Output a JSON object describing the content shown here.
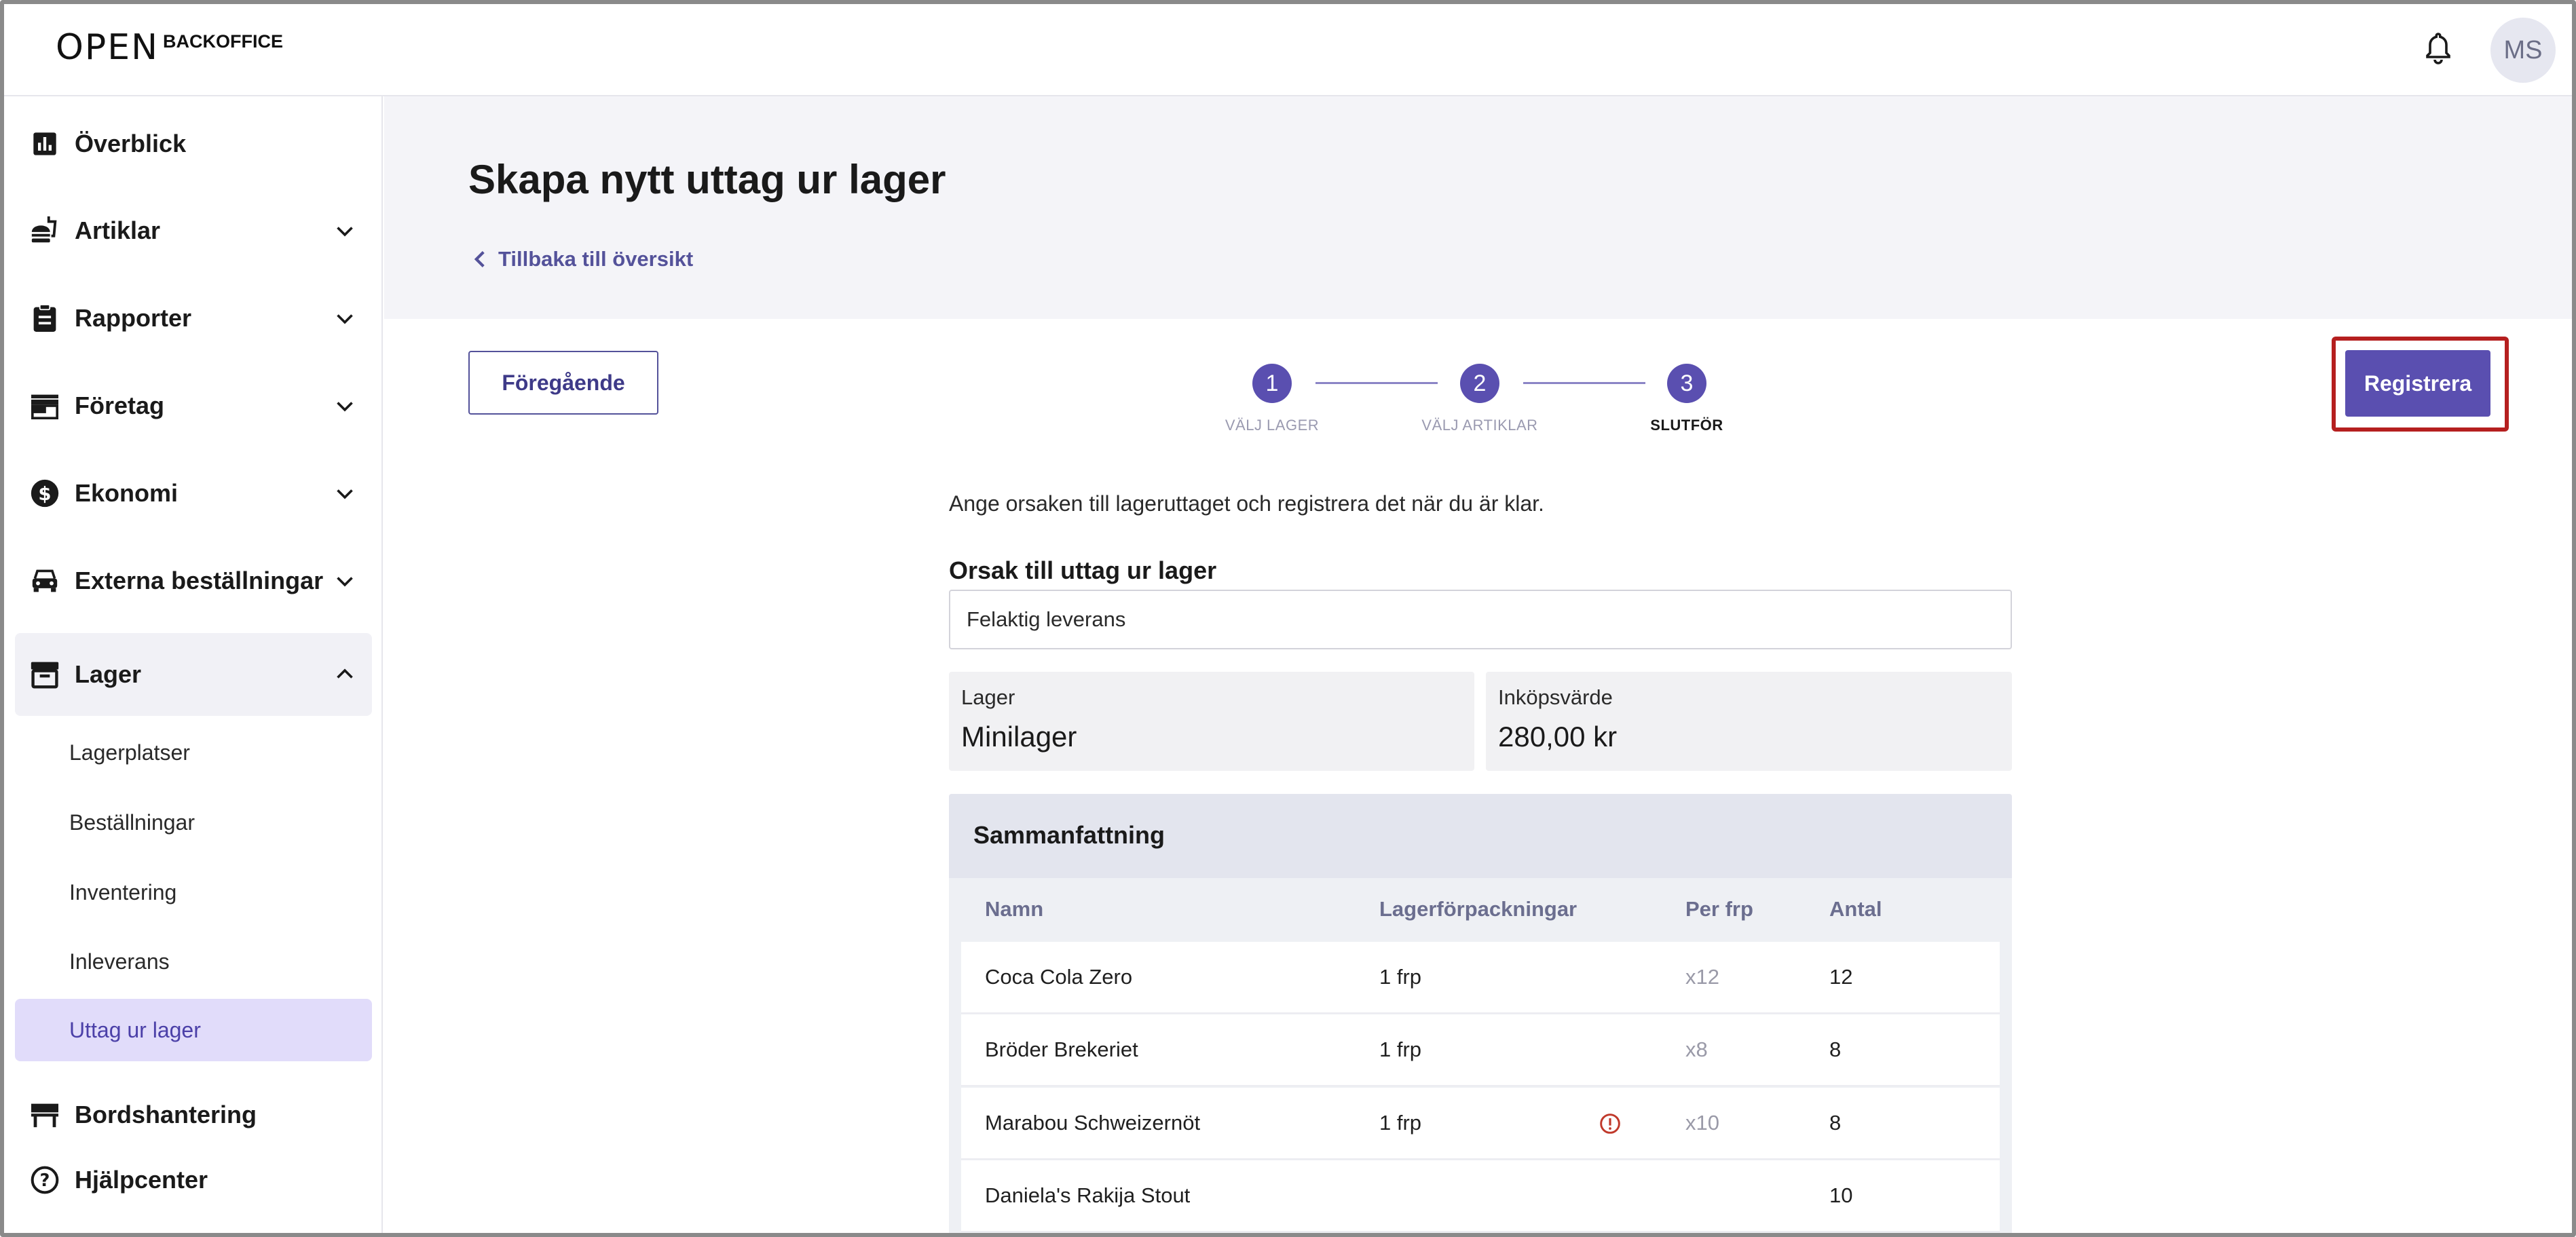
{
  "header": {
    "logo_mark": "OPEN",
    "logo_text": "BACKOFFICE",
    "avatar_initials": "MS"
  },
  "sidebar": {
    "items": [
      {
        "label": "Överblick",
        "icon": "chart-icon"
      },
      {
        "label": "Artiklar",
        "icon": "food-icon"
      },
      {
        "label": "Rapporter",
        "icon": "clipboard-icon"
      },
      {
        "label": "Företag",
        "icon": "store-icon"
      },
      {
        "label": "Ekonomi",
        "icon": "dollar-icon"
      },
      {
        "label": "Externa beställningar",
        "icon": "car-icon"
      },
      {
        "label": "Lager",
        "icon": "archive-icon"
      },
      {
        "label": "Bordshantering",
        "icon": "table-icon"
      },
      {
        "label": "Hjälpcenter",
        "icon": "help-icon"
      }
    ],
    "lager_sub": [
      "Lagerplatser",
      "Beställningar",
      "Inventering",
      "Inleverans",
      "Uttag ur lager"
    ],
    "active_sub": "Uttag ur lager"
  },
  "page": {
    "title": "Skapa nytt uttag ur lager",
    "back_link": "Tillbaka till översikt"
  },
  "stepper": {
    "prev_label": "Föregående",
    "register_label": "Registrera",
    "steps": [
      {
        "number": "1",
        "label": "VÄLJ LAGER"
      },
      {
        "number": "2",
        "label": "VÄLJ ARTIKLAR"
      },
      {
        "number": "3",
        "label": "SLUTFÖR"
      }
    ],
    "current_step": 3
  },
  "form": {
    "intro": "Ange orsaken till lageruttaget och registrera det när du är klar.",
    "reason_label": "Orsak till uttag ur lager",
    "reason_value": "Felaktig leverans",
    "cards": [
      {
        "label": "Lager",
        "value": "Minilager"
      },
      {
        "label": "Inköpsvärde",
        "value": "280,00 kr"
      }
    ]
  },
  "summary": {
    "title": "Sammanfattning",
    "columns": [
      "Namn",
      "Lagerförpackningar",
      "Per frp",
      "Antal"
    ],
    "rows": [
      {
        "name": "Coca Cola Zero",
        "packs": "1 frp",
        "per": "x12",
        "qty": "12",
        "warning": false
      },
      {
        "name": "Bröder Brekeriet",
        "packs": "1 frp",
        "per": "x8",
        "qty": "8",
        "warning": false
      },
      {
        "name": "Marabou Schweizernöt",
        "packs": "1 frp",
        "per": "x10",
        "qty": "8",
        "warning": true
      },
      {
        "name": "Daniela's Rakija Stout",
        "packs": "",
        "per": "",
        "qty": "10",
        "warning": false
      }
    ]
  },
  "colors": {
    "accent": "#5a4fb0",
    "highlight_border": "#b51f1f",
    "active_nav_bg": "#e1dcfa",
    "warning": "#c0392b"
  }
}
